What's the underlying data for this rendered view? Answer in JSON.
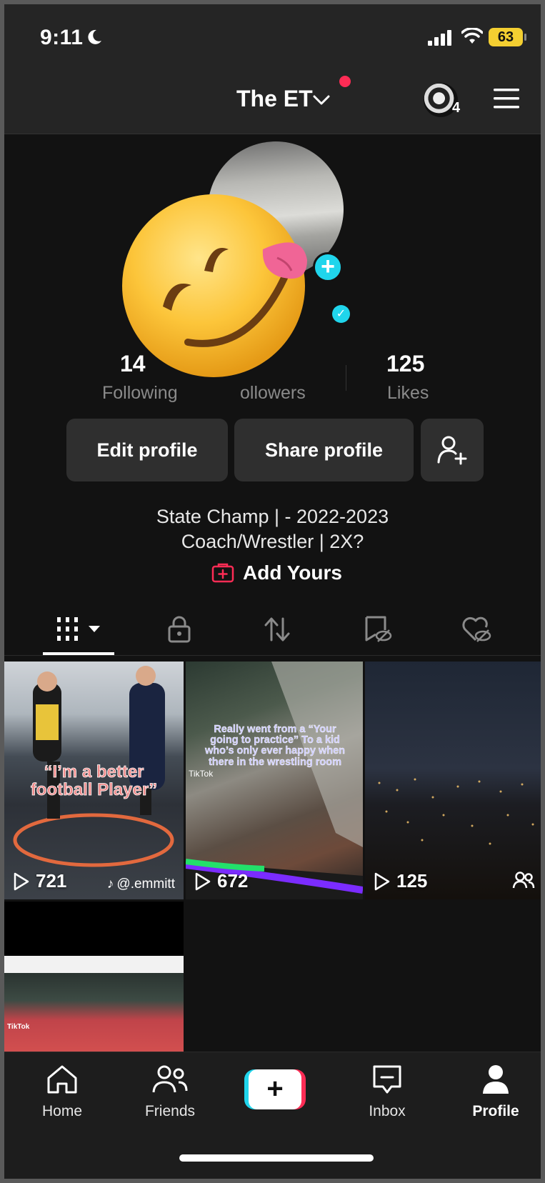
{
  "status_bar": {
    "time": "9:11",
    "battery": "63"
  },
  "header": {
    "title": "The ET",
    "notification_count": "4"
  },
  "stats": [
    {
      "value": "14",
      "label": "Following"
    },
    {
      "value": "",
      "label": "Followers"
    },
    {
      "value": "125",
      "label": "Likes"
    }
  ],
  "stats_visible": {
    "following_label": "Following",
    "followers_label": "ollowers"
  },
  "buttons": {
    "edit_profile": "Edit profile",
    "share_profile": "Share profile"
  },
  "bio": {
    "line1": "State Champ | - 2022-2023",
    "line2": "Coach/Wrestler | 2X?"
  },
  "add_yours": "Add Yours",
  "videos": [
    {
      "views": "721",
      "overlay": "“I’m a better football Player”",
      "credit": "@.emmitt"
    },
    {
      "views": "672",
      "overlay": "Really went from a “Your going to practice” To a kid who’s only ever happy when there in the wrestling room",
      "watermark": "TikTok"
    },
    {
      "views": "125"
    },
    {
      "watermark": "TikTok"
    }
  ],
  "nav": {
    "home": "Home",
    "friends": "Friends",
    "inbox": "Inbox",
    "profile": "Profile"
  },
  "colors": {
    "accent_pink": "#fe2c55",
    "accent_cyan": "#20d5ec",
    "background": "#121212"
  }
}
